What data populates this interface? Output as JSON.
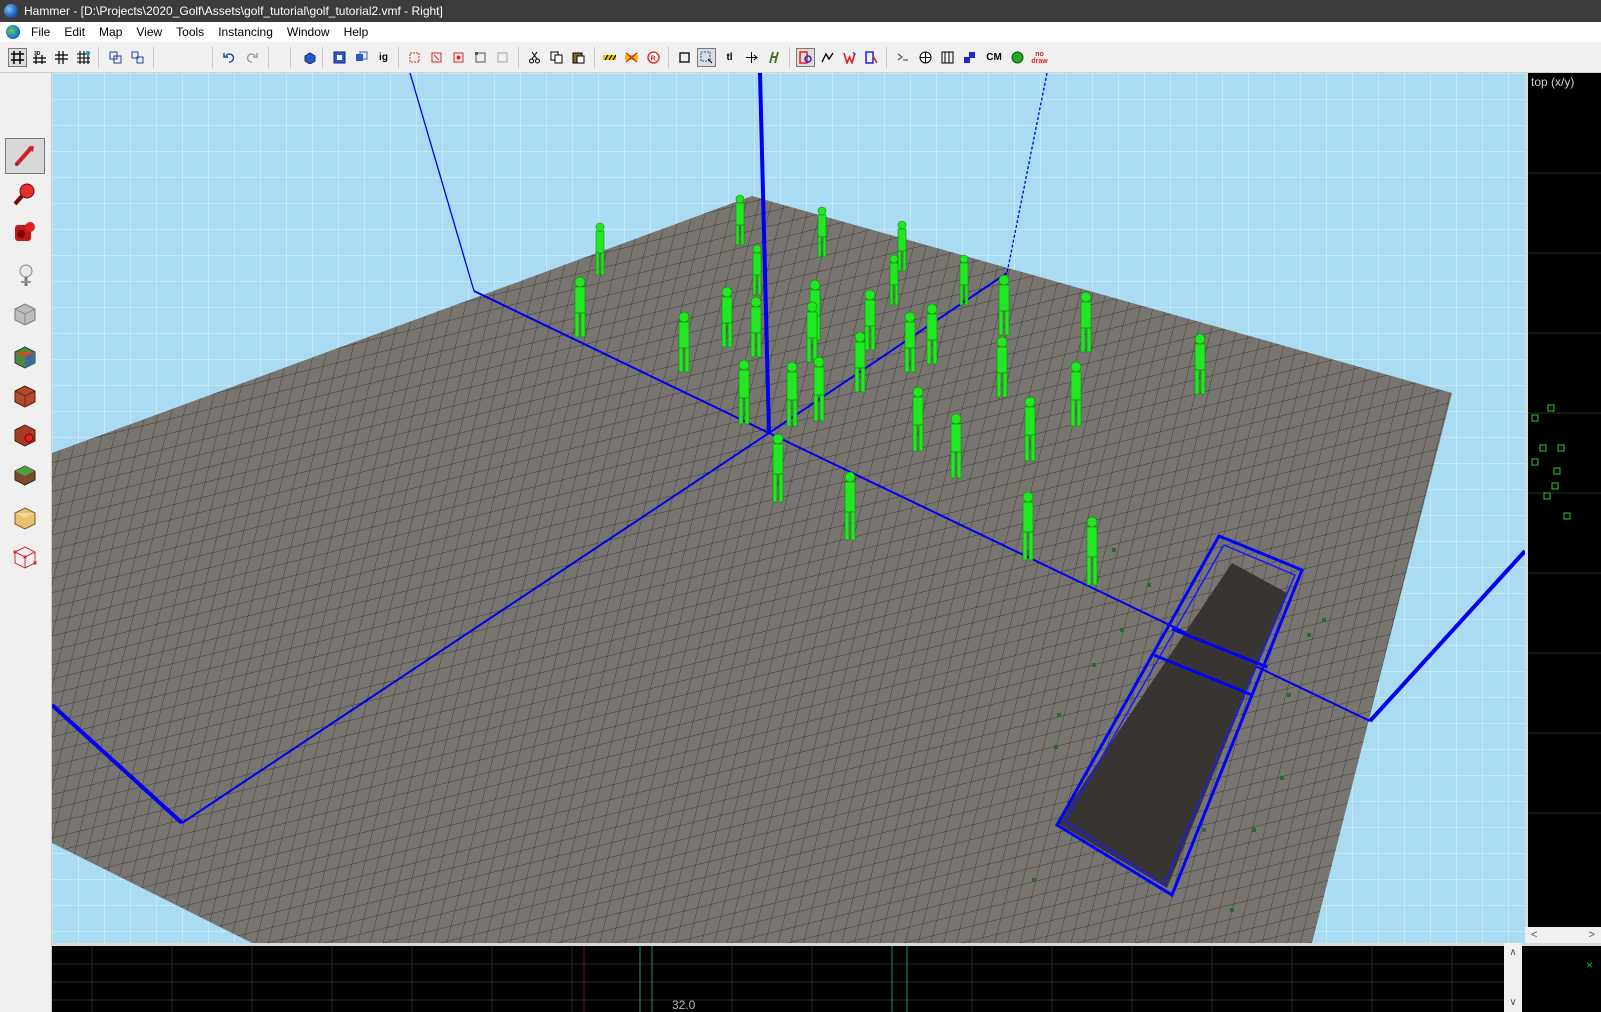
{
  "window": {
    "title": "Hammer - [D:\\Projects\\2020_Golf\\Assets\\golf_tutorial\\golf_tutorial2.vmf - Right]"
  },
  "menu": [
    "File",
    "Edit",
    "Map",
    "View",
    "Tools",
    "Instancing",
    "Window",
    "Help"
  ],
  "toolbar": {
    "grid_icons": [
      "grid-toggle-icon",
      "3d-grid-icon",
      "grid-smaller-icon",
      "grid-larger-icon"
    ],
    "undo_icon": "undo-icon",
    "redo_icon": "redo-icon",
    "text_buttons": {
      "ig": "ig",
      "tl": "tl",
      "cm": "CM",
      "draw": "no draw"
    }
  },
  "tools": [
    "selection-tool-icon",
    "magnify-tool-icon",
    "camera-tool-icon",
    "entity-tool-icon",
    "block-tool-icon",
    "texture-application-icon",
    "apply-texture-icon",
    "decal-tool-icon",
    "overlay-tool-icon",
    "clipping-tool-icon",
    "vertex-tool-icon"
  ],
  "views": {
    "right_label": "top (x/y)",
    "bottom_coord": "32.0",
    "close_glyph": "×"
  },
  "colors": {
    "sky": "#a9dcf2",
    "floor": "#7d7a76",
    "brush_outline": "#0000ff",
    "entity": "#22e822",
    "trigger": "#3a3633"
  }
}
